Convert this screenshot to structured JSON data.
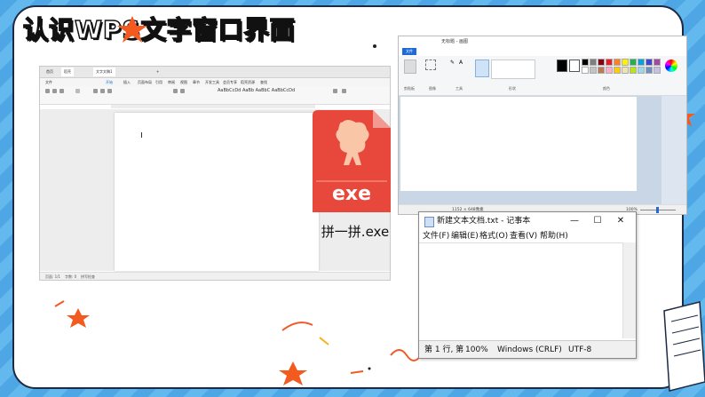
{
  "slide": {
    "title": "认识WPS文字窗口界面"
  },
  "wps": {
    "tabs": [
      "首页",
      "稻壳",
      "文字文稿1"
    ],
    "menu": [
      "文件",
      "开始",
      "插入",
      "页面布局",
      "引用",
      "审阅",
      "视图",
      "章节",
      "开发工具",
      "会员专享",
      "稻壳资源",
      "查找"
    ],
    "styles": "AaBbCcDd AaBb AaBbC AaBbCcDd",
    "status": [
      "页面: 1/1",
      "字数: 0",
      "拼写检查"
    ]
  },
  "exe": {
    "label": "exe",
    "filename": "拼一拼.exe",
    "color": "#e8483b"
  },
  "paint": {
    "title": "无标题 - 画图",
    "file_tab": "文件",
    "groups": [
      "剪贴板",
      "图像",
      "工具",
      "形状",
      "颜色"
    ],
    "status_size": "1152 × 648像素",
    "zoom": "100%",
    "colors": [
      "#000000",
      "#7f7f7f",
      "#880015",
      "#ed1c24",
      "#ff7f27",
      "#fff200",
      "#22b14c",
      "#00a2e8",
      "#3f48cc",
      "#a349a4",
      "#ffffff",
      "#c3c3c3",
      "#b97a57",
      "#ffaec9",
      "#ffc90e",
      "#efe4b0",
      "#b5e61d",
      "#99d9ea",
      "#7092be",
      "#c8bfe7"
    ]
  },
  "notepad": {
    "title": "新建文本文档.txt - 记事本",
    "minimize": "—",
    "maximize": "☐",
    "close": "✕",
    "menu": [
      "文件(F)",
      "编辑(E)",
      "格式(O)",
      "查看(V)",
      "帮助(H)"
    ],
    "status": [
      "第 1 行, 第",
      "100%",
      "Windows (CRLF)",
      "UTF-8"
    ]
  },
  "colors": {
    "sky": "#5ab0ea",
    "frame_border": "#1d2a44",
    "star": "#f25a1f",
    "swirl": "#f05a28"
  }
}
